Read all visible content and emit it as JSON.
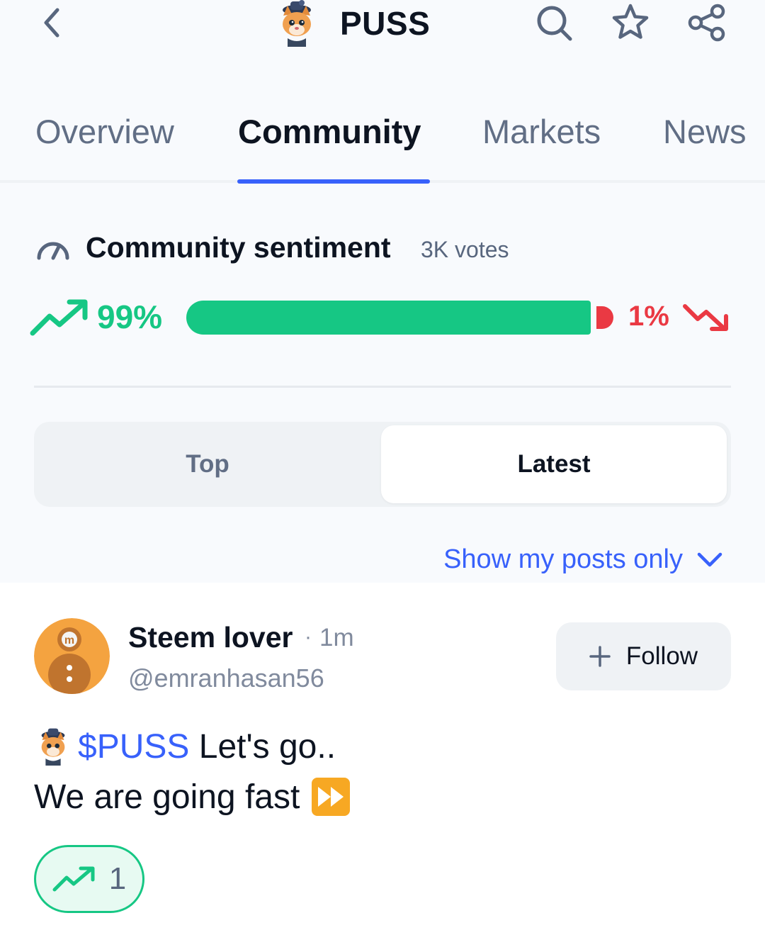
{
  "header": {
    "title": "PUSS",
    "icons": [
      "chevron-left-icon",
      "cat-coin-logo",
      "search-icon",
      "star-icon",
      "share-icon"
    ]
  },
  "tabs": [
    {
      "label": "Overview",
      "active": false
    },
    {
      "label": "Community",
      "active": true
    },
    {
      "label": "Markets",
      "active": false
    },
    {
      "label": "News",
      "active": false
    }
  ],
  "sentiment": {
    "title": "Community sentiment",
    "votes": "3K votes",
    "bullish_pct_label": "99%",
    "bearish_pct_label": "1%",
    "bullish_fraction": 0.99,
    "bearish_fraction": 0.01
  },
  "feed_toggle": {
    "options": [
      "Top",
      "Latest"
    ],
    "selected": "Latest"
  },
  "filter": {
    "label": "Show my posts only"
  },
  "post": {
    "author": "Steem lover",
    "separator": "·",
    "time": "1m",
    "handle": "@emranhasan56",
    "follow_label": "Follow",
    "cashtag": "$PUSS",
    "line1_text": " Let's go..",
    "line2_text": "We are going fast",
    "bullish_count": "1"
  },
  "colors": {
    "accent": "#3861fb",
    "bullish": "#16c784",
    "bearish": "#ea3943",
    "text_primary": "#0d1421",
    "text_secondary": "#616e85"
  }
}
